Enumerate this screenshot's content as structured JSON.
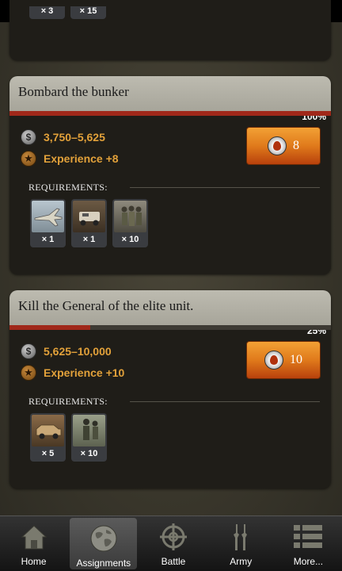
{
  "top_card": {
    "requirements": [
      {
        "qty": "× 3"
      },
      {
        "qty": "× 15"
      }
    ]
  },
  "missions": [
    {
      "title": "Bombard the bunker",
      "progress_label": "100%",
      "progress": 1.0,
      "money": "3,750–5,625",
      "experience": "Experience +8",
      "energy_cost": "8",
      "requirements_label": "REQUIREMENTS:",
      "requirements": [
        {
          "unit": "fighter-jet",
          "qty": "× 1"
        },
        {
          "unit": "armored-truck",
          "qty": "× 1"
        },
        {
          "unit": "infantry-squad",
          "qty": "× 10"
        }
      ]
    },
    {
      "title": "Kill the General of the elite unit.",
      "progress_label": "25%",
      "progress": 0.25,
      "money": "5,625–10,000",
      "experience": "Experience +10",
      "energy_cost": "10",
      "requirements_label": "REQUIREMENTS:",
      "requirements": [
        {
          "unit": "humvee",
          "qty": "× 5"
        },
        {
          "unit": "soldier",
          "qty": "× 10"
        }
      ]
    }
  ],
  "tabs": [
    {
      "label": "Home",
      "icon": "home-icon"
    },
    {
      "label": "Assignments",
      "icon": "globe-icon",
      "active": true
    },
    {
      "label": "Battle",
      "icon": "crosshair-icon"
    },
    {
      "label": "Army",
      "icon": "rifles-icon"
    },
    {
      "label": "More...",
      "icon": "menu-list-icon"
    }
  ],
  "colors": {
    "accent_orange": "#e07a1b",
    "reward_text": "#e2a13a",
    "progress_red": "#a0281a"
  }
}
